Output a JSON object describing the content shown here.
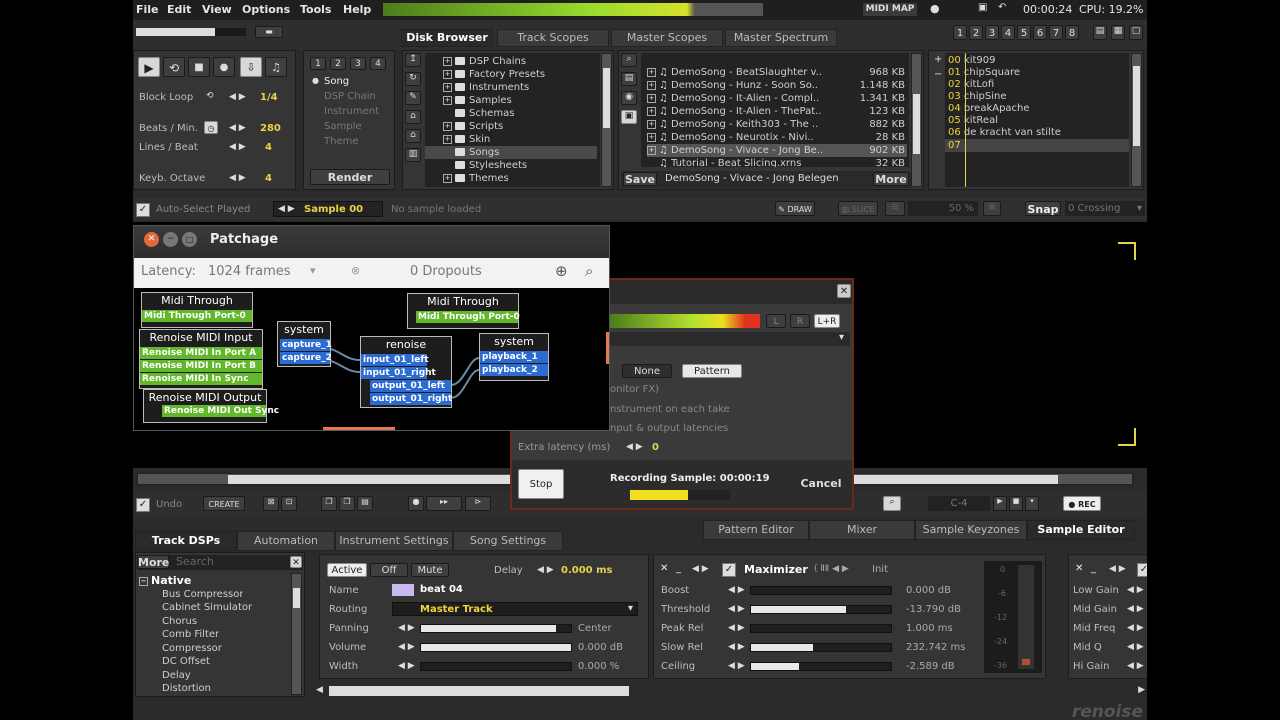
{
  "menu": [
    "File",
    "Edit",
    "View",
    "Options",
    "Tools",
    "Help"
  ],
  "topbar": {
    "midi_map": "MIDI MAP",
    "time": "00:00:24",
    "cpu": "CPU: 19.2%",
    "tracks": [
      "1",
      "2",
      "3",
      "4",
      "5",
      "6",
      "7",
      "8"
    ]
  },
  "transport": {
    "block_loop_label": "Block Loop",
    "block_loop_val": "1/4",
    "bpm_label": "Beats / Min.",
    "bpm_val": "280",
    "lpb_label": "Lines / Beat",
    "lpb_val": "4",
    "octave_label": "Keyb. Octave",
    "octave_val": "4"
  },
  "render_panel": {
    "tabs": [
      "1",
      "2",
      "3",
      "4"
    ],
    "items": [
      "Song",
      "DSP Chain",
      "Instrument",
      "Sample",
      "Theme"
    ],
    "render": "Render"
  },
  "browser_tabs": [
    "Disk Browser",
    "Track Scopes",
    "Master Scopes",
    "Master Spectrum"
  ],
  "folders": [
    "DSP Chains",
    "Factory Presets",
    "Instruments",
    "Samples",
    "Schemas",
    "Scripts",
    "Skin",
    "Songs",
    "Stylesheets",
    "Themes"
  ],
  "files": [
    {
      "name": "DemoSong - BeatSlaughter v..",
      "size": "968 KB"
    },
    {
      "name": "DemoSong - Hunz - Soon So..",
      "size": "1.148 KB"
    },
    {
      "name": "DemoSong - It-Alien - Compl..",
      "size": "1.341 KB"
    },
    {
      "name": "DemoSong - It-Alien - ThePat..",
      "size": "123 KB"
    },
    {
      "name": "DemoSong - Keith303 - The ..",
      "size": "882 KB"
    },
    {
      "name": "DemoSong - Neurotix - Nivi..",
      "size": "28 KB"
    },
    {
      "name": "DemoSong - Vivace - Jong Be..",
      "size": "902 KB"
    },
    {
      "name": "Tutorial - Beat Slicing.xrns",
      "size": "32 KB"
    }
  ],
  "file_footer": {
    "save": "Save",
    "current": "DemoSong - Vivace - Jong Belegen",
    "more": "More"
  },
  "instruments": [
    {
      "num": "00",
      "name": "kit909"
    },
    {
      "num": "01",
      "name": "chipSquare"
    },
    {
      "num": "02",
      "name": "kitLofi"
    },
    {
      "num": "03",
      "name": "chipSine"
    },
    {
      "num": "04",
      "name": "breakApache"
    },
    {
      "num": "05",
      "name": "kitReal"
    },
    {
      "num": "06",
      "name": "de kracht van stilte"
    },
    {
      "num": "07",
      "name": ""
    }
  ],
  "sample_bar": {
    "auto_select": "Auto-Select Played",
    "sample": "Sample 00",
    "no_sample": "No sample loaded",
    "draw": "DRAW",
    "slice": "SLICE",
    "zoom": "50 %",
    "snap": "Snap",
    "crossing": "0 Crossing"
  },
  "patchage": {
    "title": "Patchage",
    "latency_label": "Latency:",
    "latency_val": "1024 frames",
    "dropouts": "0 Dropouts",
    "midi_through_1": "Midi Through",
    "midi_through_port_1": "Midi Through Port-0",
    "renoise_midi_input": "Renoise MIDI Input",
    "input_ports": [
      "Renoise MIDI In Port A",
      "Renoise MIDI In Port B",
      "Renoise MIDI In Sync"
    ],
    "renoise_midi_output": "Renoise MIDI Output",
    "output_port": "Renoise MIDI Out Sync",
    "system_1": "system",
    "capture": [
      "capture_1",
      "capture_2"
    ],
    "renoise": "renoise",
    "renoise_ports": [
      "input_01_left",
      "input_01_right",
      "output_01_left",
      "output_01_right"
    ],
    "midi_through_2": "Midi Through",
    "midi_through_port_2": "Midi Through Port-0",
    "system_2": "system",
    "playback": [
      "playback_1",
      "playback_2"
    ]
  },
  "recorder": {
    "lr": [
      "L",
      "R",
      "L+R"
    ],
    "none": "None",
    "pattern": "Pattern",
    "monitor": "onitor FX)",
    "instrument_take": "nstrument on each take",
    "latencies": "nput & output latencies",
    "extra_latency_label": "Extra latency (ms)",
    "extra_latency_val": "0",
    "stop": "Stop",
    "status": "Recording Sample: 00:00:19",
    "cancel": "Cancel",
    "progress": 0.58
  },
  "edit_bar": {
    "undo": "Undo",
    "create": "CREATE",
    "note": "C-4",
    "rec": "REC"
  },
  "lower_tabs_right": [
    "Pattern Editor",
    "Mixer",
    "Sample Keyzones",
    "Sample Editor"
  ],
  "lower_tabs_left": [
    "Track DSPs",
    "Automation",
    "Instrument Settings",
    "Song Settings"
  ],
  "dsp_list": {
    "more": "More",
    "search": "Search",
    "group": "Native",
    "items": [
      "Bus Compressor",
      "Cabinet Simulator",
      "Chorus",
      "Comb Filter",
      "Compressor",
      "DC Offset",
      "Delay",
      "Distortion"
    ]
  },
  "track": {
    "active": "Active",
    "off": "Off",
    "mute": "Mute",
    "delay_label": "Delay",
    "delay_val": "0.000 ms",
    "name_label": "Name",
    "name_val": "beat 04",
    "routing_label": "Routing",
    "routing_val": "Master Track",
    "panning_label": "Panning",
    "panning_val": "Center",
    "panning_level": 0.9,
    "volume_label": "Volume",
    "volume_val": "0.000 dB",
    "volume_level": 1.0,
    "width_label": "Width",
    "width_val": "0.000 %",
    "width_level": 0.0
  },
  "maximizer": {
    "title": "Maximizer",
    "init": "Init",
    "params": [
      {
        "label": "Boost",
        "value": "0.000 dB",
        "level": 0.0
      },
      {
        "label": "Threshold",
        "value": "-13.790 dB",
        "level": 0.68
      },
      {
        "label": "Peak Rel",
        "value": "1.000 ms",
        "level": 0.0
      },
      {
        "label": "Slow Rel",
        "value": "232.742 ms",
        "level": 0.44
      },
      {
        "label": "Ceiling",
        "value": "-2.589 dB",
        "level": 0.34
      }
    ],
    "meter_labels": [
      "0",
      "-6",
      "-12",
      "-24",
      "-36"
    ]
  },
  "eq": {
    "params": [
      "Low Gain",
      "Mid Gain",
      "Mid Freq",
      "Mid Q",
      "Hi Gain"
    ]
  },
  "logo": "renoise"
}
